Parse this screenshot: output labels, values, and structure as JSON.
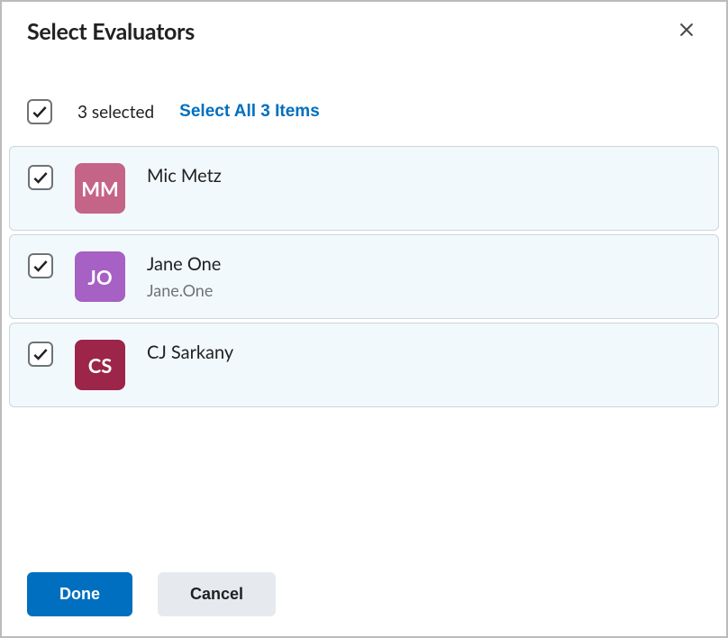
{
  "dialog": {
    "title": "Select Evaluators"
  },
  "selection": {
    "count_text": "3 selected",
    "select_all_label": "Select All 3 Items"
  },
  "evaluators": {
    "items": [
      {
        "initials": "MM",
        "name": "Mic Metz",
        "sub": "",
        "avatar_color": "#c46487",
        "checked": true
      },
      {
        "initials": "JO",
        "name": "Jane One",
        "sub": "Jane.One",
        "avatar_color": "#a760c4",
        "checked": true
      },
      {
        "initials": "CS",
        "name": "CJ Sarkany",
        "sub": "",
        "avatar_color": "#9c2549",
        "checked": true
      }
    ]
  },
  "footer": {
    "done_label": "Done",
    "cancel_label": "Cancel"
  }
}
